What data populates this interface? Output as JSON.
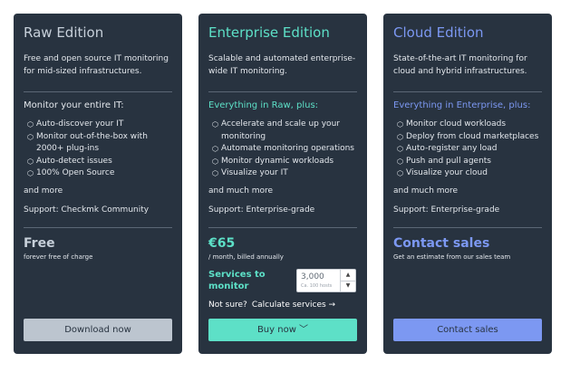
{
  "colors": {
    "card_bg": "#283340",
    "raw_accent": "#c7d0da",
    "enterprise_accent": "#5de0c7",
    "cloud_accent": "#7c98f2"
  },
  "raw": {
    "title": "Raw Edition",
    "description": "Free and open source IT monitoring for mid-sized infrastructures.",
    "subhead": "Monitor your entire IT:",
    "features": [
      "Auto-discover your IT",
      "Monitor out-of-the-box with 2000+ plug-ins",
      "Auto-detect issues",
      "100% Open Source"
    ],
    "more": "and more",
    "support": "Support: Checkmk Community",
    "price": "Free",
    "price_note": "forever free of charge",
    "button": "Download now"
  },
  "enterprise": {
    "title": "Enterprise Edition",
    "description": "Scalable and automated enterprise-wide IT monitoring.",
    "subhead": "Everything in Raw, plus:",
    "features": [
      "Accelerate and scale up your monitoring",
      "Automate monitoring operations",
      "Monitor dynamic workloads",
      "Visualize your IT"
    ],
    "more": "and much more",
    "support": "Support: Enterprise-grade",
    "price": "€65",
    "price_note": "/ month, billed annually",
    "services_label": "Services to monitor",
    "services_value": "3,000",
    "services_hint": "Ca. 100 hosts",
    "not_sure": "Not sure?",
    "calculate": "Calculate services →",
    "button": "Buy now ﹀"
  },
  "cloud": {
    "title": "Cloud Edition",
    "description": "State-of-the-art IT monitoring for cloud and hybrid infrastructures.",
    "subhead": "Everything in Enterprise, plus:",
    "features": [
      "Monitor cloud workloads",
      "Deploy from cloud marketplaces",
      "Auto-register any load",
      "Push and pull agents",
      "Visualize your cloud"
    ],
    "more": "and much more",
    "support": "Support: Enterprise-grade",
    "price": "Contact sales",
    "price_note": "Get an estimate from our sales team",
    "button": "Contact sales"
  }
}
